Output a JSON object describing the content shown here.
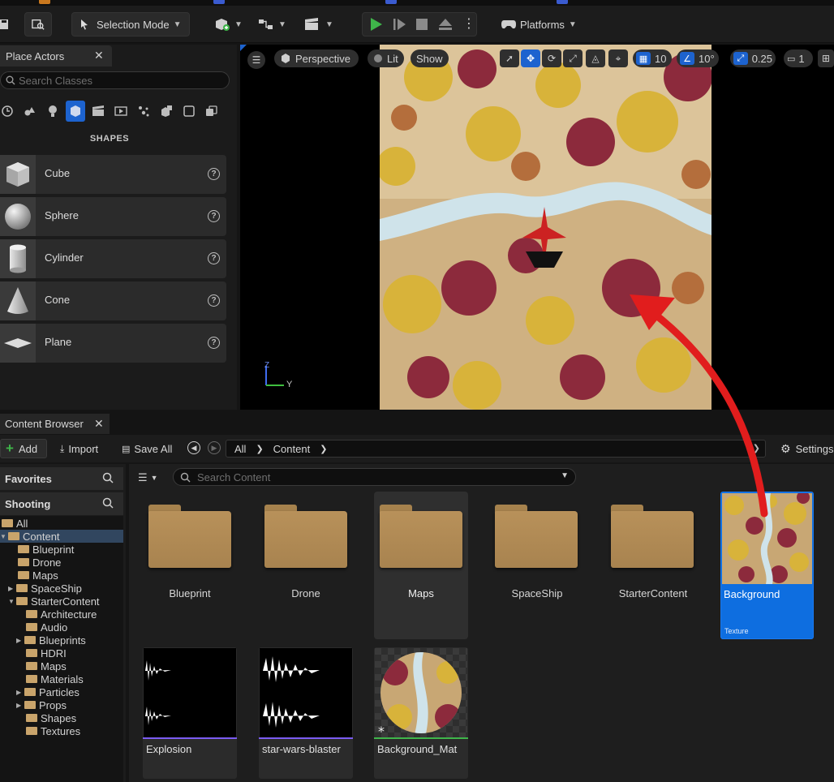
{
  "toolbar": {
    "mode_label": "Selection Mode",
    "platforms_label": "Platforms"
  },
  "place_actors": {
    "tab_label": "Place Actors",
    "search_placeholder": "Search Classes",
    "section_label": "SHAPES",
    "items": [
      {
        "label": "Cube",
        "icon": "cube-icon"
      },
      {
        "label": "Sphere",
        "icon": "sphere-icon"
      },
      {
        "label": "Cylinder",
        "icon": "cylinder-icon"
      },
      {
        "label": "Cone",
        "icon": "cone-icon"
      },
      {
        "label": "Plane",
        "icon": "plane-icon"
      }
    ]
  },
  "viewport": {
    "view_mode": "Perspective",
    "lighting": "Lit",
    "show_label": "Show",
    "grid_snap": "10",
    "rotation_snap": "10°",
    "scale_snap": "0.25",
    "camera_speed": "1",
    "axis_z": "Z",
    "axis_y": "Y"
  },
  "content_browser": {
    "tab_label": "Content Browser",
    "add_label": "Add",
    "import_label": "Import",
    "save_all_label": "Save All",
    "path": [
      "All",
      "Content"
    ],
    "settings_label": "Settings",
    "favorites_label": "Favorites",
    "project_label": "Shooting",
    "search_placeholder": "Search Content",
    "tree": [
      {
        "label": "All"
      },
      {
        "label": "Content"
      },
      {
        "label": "Blueprint"
      },
      {
        "label": "Drone"
      },
      {
        "label": "Maps"
      },
      {
        "label": "SpaceShip"
      },
      {
        "label": "StarterContent"
      },
      {
        "label": "Architecture"
      },
      {
        "label": "Audio"
      },
      {
        "label": "Blueprints"
      },
      {
        "label": "HDRI"
      },
      {
        "label": "Maps"
      },
      {
        "label": "Materials"
      },
      {
        "label": "Particles"
      },
      {
        "label": "Props"
      },
      {
        "label": "Shapes"
      },
      {
        "label": "Textures"
      }
    ],
    "folders": [
      "Blueprint",
      "Drone",
      "Maps",
      "SpaceShip",
      "StarterContent"
    ],
    "texture_asset": {
      "name": "Background",
      "type": "Texture"
    },
    "assets": [
      {
        "name": "Explosion",
        "kind": "sound"
      },
      {
        "name": "star-wars-blaster",
        "kind": "sound"
      },
      {
        "name": "Background_Mat",
        "kind": "material"
      }
    ]
  },
  "colors": {
    "selection_blue": "#0e6ee0",
    "annotation_red": "#e11d1d",
    "play_green": "#3fb54a",
    "folder_tan": "#b38d57"
  }
}
